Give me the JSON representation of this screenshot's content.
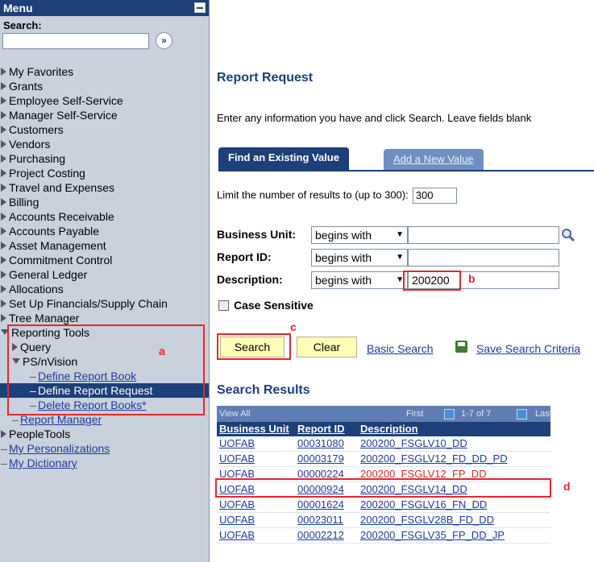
{
  "menu": {
    "title": "Menu",
    "search_label": "Search:",
    "search_go": "»",
    "items": [
      {
        "label": "My Favorites",
        "type": "folder"
      },
      {
        "label": "Grants",
        "type": "folder"
      },
      {
        "label": "Employee Self-Service",
        "type": "folder"
      },
      {
        "label": "Manager Self-Service",
        "type": "folder"
      },
      {
        "label": "Customers",
        "type": "folder"
      },
      {
        "label": "Vendors",
        "type": "folder"
      },
      {
        "label": "Purchasing",
        "type": "folder"
      },
      {
        "label": "Project Costing",
        "type": "folder"
      },
      {
        "label": "Travel and Expenses",
        "type": "folder"
      },
      {
        "label": "Billing",
        "type": "folder"
      },
      {
        "label": "Accounts Receivable",
        "type": "folder"
      },
      {
        "label": "Accounts Payable",
        "type": "folder"
      },
      {
        "label": "Asset Management",
        "type": "folder"
      },
      {
        "label": "Commitment Control",
        "type": "folder"
      },
      {
        "label": "General Ledger",
        "type": "folder"
      },
      {
        "label": "Allocations",
        "type": "folder"
      },
      {
        "label": "Set Up Financials/Supply Chain",
        "type": "folder"
      },
      {
        "label": "Tree Manager",
        "type": "folder"
      },
      {
        "label": "Reporting Tools",
        "type": "folder-open"
      },
      {
        "label": "Query",
        "type": "folder-sub"
      },
      {
        "label": "PS/nVision",
        "type": "folder-sub-open"
      },
      {
        "label": "Define Report Book",
        "type": "link-sub2"
      },
      {
        "label": "Define Report Request",
        "type": "link-sub2-selected"
      },
      {
        "label": "Delete Report Books*",
        "type": "link-sub2"
      },
      {
        "label": "Report Manager",
        "type": "link-sub"
      },
      {
        "label": "PeopleTools",
        "type": "folder"
      },
      {
        "label": "My Personalizations",
        "type": "link"
      },
      {
        "label": "My Dictionary",
        "type": "link"
      }
    ]
  },
  "main": {
    "page_title": "Report Request",
    "instructions": "Enter any information you have and click Search. Leave fields blank",
    "tabs": {
      "active": "Find an Existing Value",
      "inactive": "Add a New Value"
    },
    "limit_label": "Limit the number of results to (up to 300):",
    "limit_value": "300",
    "fields": {
      "business_unit": {
        "label": "Business Unit:",
        "operator": "begins with",
        "value": ""
      },
      "report_id": {
        "label": "Report ID:",
        "operator": "begins with",
        "value": ""
      },
      "description": {
        "label": "Description:",
        "operator": "begins with",
        "value": "200200"
      }
    },
    "case_sensitive": "Case Sensitive",
    "buttons": {
      "search": "Search",
      "clear": "Clear",
      "basic_search": "Basic Search",
      "save_criteria": "Save Search Criteria"
    },
    "results": {
      "title": "Search Results",
      "view_all": "View All",
      "first": "First",
      "count": "1-7 of 7",
      "last": "Last",
      "columns": [
        "Business Unit",
        "Report ID",
        "Description"
      ],
      "rows": [
        {
          "bu": "UOFAB",
          "id": "00031080",
          "desc": "200200_FSGLV10_DD"
        },
        {
          "bu": "UOFAB",
          "id": "00003179",
          "desc": "200200_FSGLV12_FD_DD_PD"
        },
        {
          "bu": "UOFAB",
          "id": "00000224",
          "desc": "200200_FSGLV12_FP_DD"
        },
        {
          "bu": "UOFAB",
          "id": "00000924",
          "desc": "200200_FSGLV14_DD"
        },
        {
          "bu": "UOFAB",
          "id": "00001624",
          "desc": "200200_FSGLV16_FN_DD"
        },
        {
          "bu": "UOFAB",
          "id": "00023011",
          "desc": "200200_FSGLV28B_FD_DD"
        },
        {
          "bu": "UOFAB",
          "id": "00002212",
          "desc": "200200_FSGLV35_FP_DD_JP"
        }
      ]
    }
  },
  "annotations": {
    "a": "a",
    "b": "b",
    "c": "c",
    "d": "d"
  },
  "colors": {
    "accent": "#1d3f7a",
    "annotation": "#e8262c",
    "link": "#1f3c9d",
    "sidebar_bg": "#c8d1dc",
    "button_bg": "#ffffb8"
  }
}
